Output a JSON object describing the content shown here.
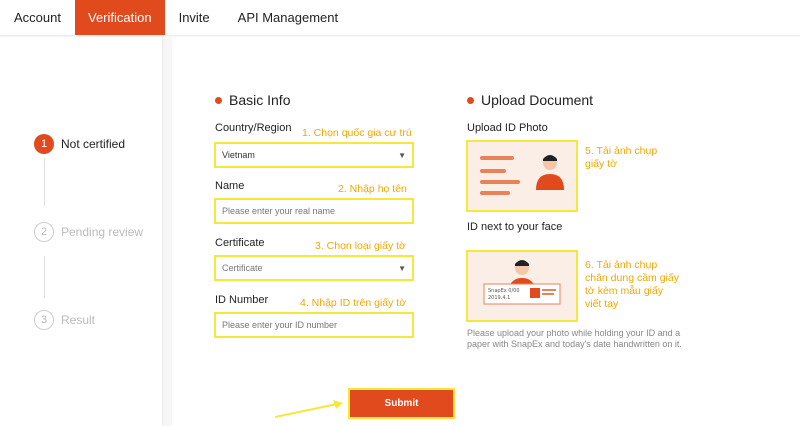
{
  "tabs": [
    {
      "label": "Account",
      "active": false
    },
    {
      "label": "Verification",
      "active": true
    },
    {
      "label": "Invite",
      "active": false
    },
    {
      "label": "API Management",
      "active": false
    }
  ],
  "steps": [
    {
      "num": "1",
      "label": "Not certified",
      "active": true
    },
    {
      "num": "2",
      "label": "Pending review",
      "active": false
    },
    {
      "num": "3",
      "label": "Result",
      "active": false
    }
  ],
  "basic_info": {
    "title": "Basic Info",
    "country": {
      "label": "Country/Region",
      "hint": "1. Chọn quốc gia cư trú",
      "value": "Vietnam"
    },
    "name": {
      "label": "Name",
      "hint": "2. Nhập họ tên",
      "placeholder": "Please enter your real name"
    },
    "certificate": {
      "label": "Certificate",
      "hint": "3. Chọn loại giấy tờ",
      "value": "Certificate"
    },
    "id_number": {
      "label": "ID Number",
      "hint": "4. Nhập ID trên giấy tờ",
      "placeholder": "Please enter your ID number"
    }
  },
  "upload": {
    "title": "Upload Document",
    "id_photo": {
      "label": "Upload ID Photo",
      "hint": "5. Tải ảnh chụp giấy tờ"
    },
    "id_face": {
      "label": "ID next to your face",
      "hint": "6. Tải ảnh chụp chân dung cầm giấy tờ kèm mẫu giấy viết tay",
      "paper_text_1": "SnapEx 0/00",
      "paper_text_2": "2019.4.1"
    },
    "note": "Please upload your photo while holding your ID and a paper with SnapEx and today's date handwritten on it."
  },
  "submit_label": "Submit",
  "colors": {
    "accent": "#e04a1c",
    "highlight": "#f5e83a",
    "hint": "#f0a800"
  }
}
